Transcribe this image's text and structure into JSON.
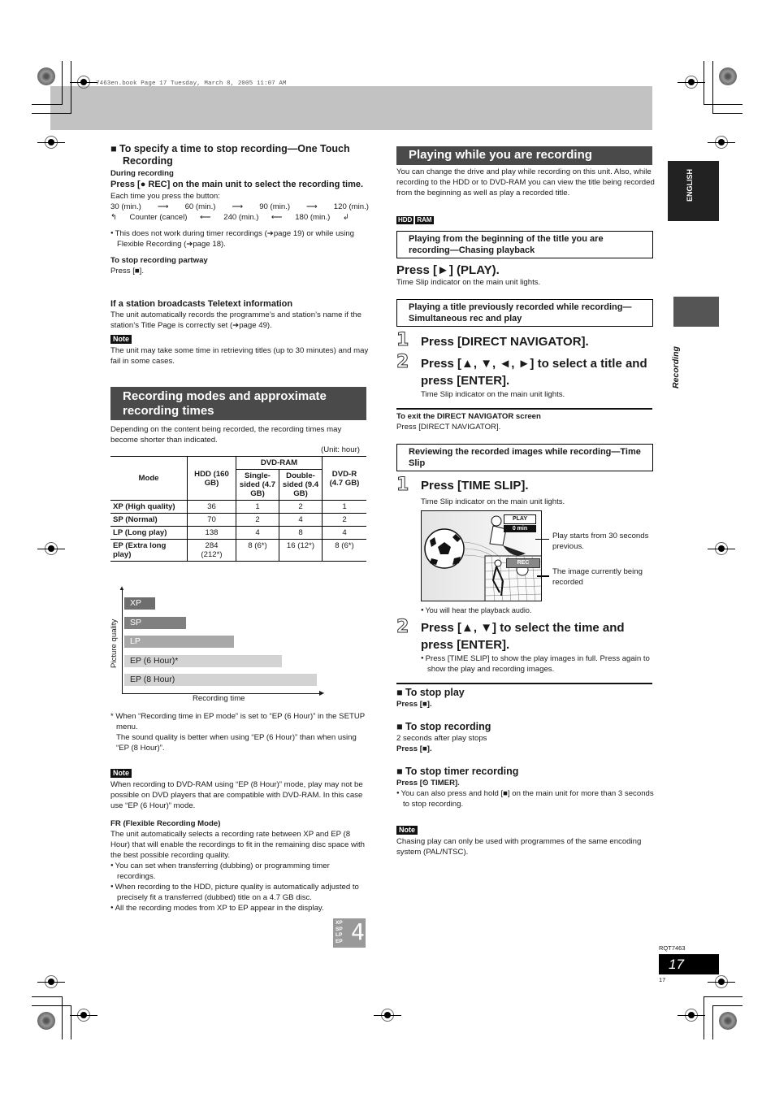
{
  "header": {
    "book_line": "7463en.book  Page 17  Tuesday, March 8, 2005  11:07 AM"
  },
  "left": {
    "one_touch": {
      "heading": "To specify a time to stop recording—One Touch Recording",
      "during_label": "During recording",
      "instruction": "Press [● REC] on the main unit to select the recording time.",
      "each_time": "Each time you press the button:",
      "cycle_row1": [
        "30 (min.)",
        "60 (min.)",
        "90 (min.)",
        "120 (min.)"
      ],
      "cycle_row2": [
        "Counter (cancel)",
        "240 (min.)",
        "180 (min.)"
      ],
      "bullet": "This does not work during timer recordings (➔page 19) or while using Flexible Recording (➔page 18).",
      "stop_partway_label": "To stop recording partway",
      "stop_partway_text": "Press [■]."
    },
    "teletext": {
      "heading": "If a station broadcasts Teletext information",
      "body": "The unit automatically records the programme’s and station’s name if the station’s Title Page is correctly set (➔page 49).",
      "note_label": "Note",
      "note_text": "The unit may take some time in retrieving titles (up to 30 minutes) and may fail in some cases."
    },
    "modes": {
      "title": "Recording modes and approximate recording times",
      "intro": "Depending on the content being recorded, the recording times may become shorter than indicated.",
      "unit": "(Unit: hour)",
      "table": {
        "headers": {
          "mode": "Mode",
          "hdd": "HDD (160 GB)",
          "dvd_ram": "DVD-RAM",
          "single": "Single-sided (4.7 GB)",
          "double": "Double-sided (9.4 GB)",
          "dvdr": "DVD-R (4.7 GB)"
        },
        "rows": [
          {
            "mode": "XP (High quality)",
            "hdd": "36",
            "hdd_alt": "",
            "single": "1",
            "double": "2",
            "dvdr": "1"
          },
          {
            "mode": "SP (Normal)",
            "hdd": "70",
            "hdd_alt": "",
            "single": "2",
            "double": "4",
            "dvdr": "2"
          },
          {
            "mode": "LP (Long play)",
            "hdd": "138",
            "hdd_alt": "",
            "single": "4",
            "double": "8",
            "dvdr": "4"
          },
          {
            "mode": "EP (Extra long play)",
            "hdd": "284",
            "hdd_alt": "(212*)",
            "single": "8 (6*)",
            "double": "16 (12*)",
            "dvdr": "8 (6*)"
          }
        ]
      },
      "chart": {
        "ylabel": "Picture quality",
        "xlabel": "Recording time",
        "bars": [
          {
            "label": "XP",
            "relative_length": 0.16,
            "color": "#6e6e6e",
            "text_color": "#ffffff"
          },
          {
            "label": "SP",
            "relative_length": 0.32,
            "color": "#808080",
            "text_color": "#ffffff"
          },
          {
            "label": "LP",
            "relative_length": 0.57,
            "color": "#a8a8a8",
            "text_color": "#ffffff"
          },
          {
            "label": "EP (6 Hour)*",
            "relative_length": 0.82,
            "color": "#d3d3d3",
            "text_color": "#222222"
          },
          {
            "label": "EP (8 Hour)",
            "relative_length": 1.0,
            "color": "#d3d3d3",
            "text_color": "#222222"
          }
        ]
      },
      "footnote_line1": "When “Recording time in EP mode” is set to “EP (6 Hour)” in the SETUP menu.",
      "footnote_line2": "The sound quality is better when using “EP (6 Hour)” than when using “EP (8 Hour)”.",
      "note_label": "Note",
      "note_text": "When recording to DVD-RAM using “EP (8 Hour)” mode, play may not be possible on DVD players that are compatible with DVD-RAM. In this case use “EP (6 Hour)” mode."
    },
    "fr": {
      "heading": "FR (Flexible Recording Mode)",
      "body": "The unit automatically selects a recording rate between XP and EP (8 Hour) that will enable the recordings to fit in the remaining disc space with the best possible recording quality.",
      "bullets": [
        "You can set when transferring (dubbing) or programming timer recordings.",
        "When recording to the HDD, picture quality is automatically adjusted to precisely fit a transferred (dubbed) title on a 4.7 GB disc.",
        "All the recording modes from XP to EP appear in the display."
      ],
      "display_modes": [
        "XP",
        "SP",
        "LP",
        "EP"
      ],
      "display_digit": "4"
    }
  },
  "right": {
    "title": "Playing while you are recording",
    "intro": "You can change the drive and play while recording on this unit. Also, while recording to the HDD or to DVD-RAM you can view the title being recorded from the beginning as well as play a recorded title.",
    "tags": [
      "HDD",
      "RAM"
    ],
    "chasing": {
      "box": "Playing from the beginning of the title you are recording—Chasing playback",
      "press": "Press [►] (PLAY).",
      "note": "Time Slip indicator on the main unit lights."
    },
    "simultaneous": {
      "box": "Playing a title previously recorded while recording—Simultaneous rec and play",
      "steps": [
        {
          "num": "1",
          "text": "Press [DIRECT NAVIGATOR].",
          "sub": ""
        },
        {
          "num": "2",
          "text": "Press [▲, ▼, ◄, ►] to select a title and press [ENTER].",
          "sub": "Time Slip indicator on the main unit lights."
        }
      ],
      "exit_label": "To exit the DIRECT NAVIGATOR screen",
      "exit_text": "Press [DIRECT NAVIGATOR]."
    },
    "timeslip": {
      "box": "Reviewing the recorded images while recording—Time Slip",
      "step1": "Press [TIME SLIP].",
      "step1_sub": "Time Slip indicator on the main unit lights.",
      "illustration": {
        "play_label": "PLAY",
        "time_label": "0 min",
        "rec_label": "REC",
        "callout_play": "Play starts from 30 seconds previous.",
        "callout_rec": "The image currently being recorded"
      },
      "bullet_audio": "You will hear the playback audio.",
      "step2": "Press [▲, ▼] to select the time and press [ENTER].",
      "step2_bullet": "Press [TIME SLIP] to show the play images in full. Press again to show the play and recording images."
    },
    "stop_play": {
      "heading": "To stop play",
      "text": "Press [■]."
    },
    "stop_recording": {
      "heading": "To stop recording",
      "line1": "2 seconds after play stops",
      "line2": "Press [■]."
    },
    "stop_timer": {
      "heading": "To stop timer recording",
      "text": "Press [⏲ TIMER].",
      "bullet": "You can also press and hold [■] on the main unit for more than 3 seconds to stop recording."
    },
    "note_label": "Note",
    "note_text": "Chasing play can only be used with programmes of the same encoding system (PAL/NTSC)."
  },
  "side": {
    "language_tab": "ENGLISH",
    "section_tab": "Recording"
  },
  "footer": {
    "doc_code": "RQT7463",
    "page_number": "17",
    "page_small": "17"
  }
}
